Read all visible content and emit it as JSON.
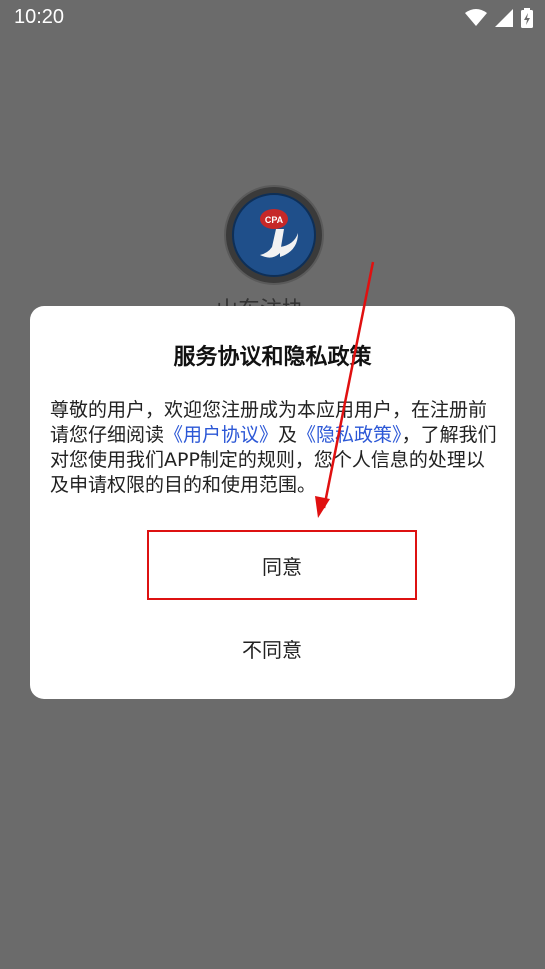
{
  "status_bar": {
    "time": "10:20"
  },
  "background_app": {
    "name_partial": "山东注协"
  },
  "dialog": {
    "title": "服务协议和隐私政策",
    "body_text_1": "尊敬的用户，欢迎您注册成为本应用用户，在注册前请您仔细阅读",
    "user_agreement_link": "《用户协议》",
    "connector": "及",
    "privacy_policy_link": "《隐私政策》",
    "body_text_2": "，了解我们对您使用我们APP制定的规则，您个人信息的处理以及申请权限的目的和使用范围。",
    "agree_label": "同意",
    "disagree_label": "不同意"
  },
  "colors": {
    "overlay": "#6b6b6b",
    "link": "#2b57d6",
    "highlight": "#dd1111"
  }
}
